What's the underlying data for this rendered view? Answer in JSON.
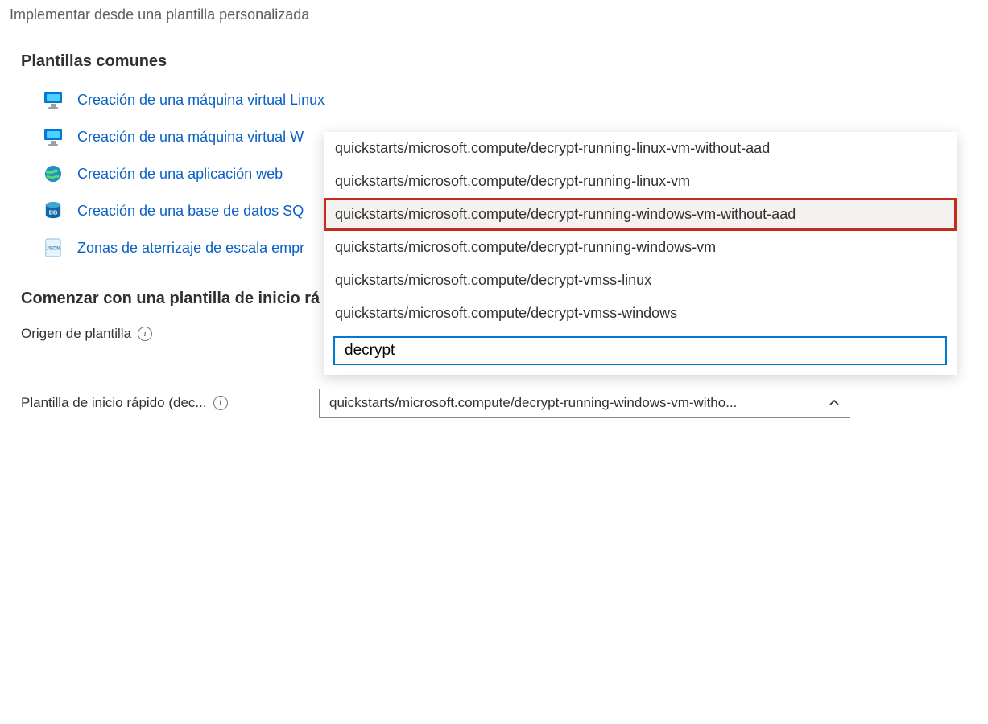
{
  "page": {
    "title": "Implementar desde una plantilla personalizada"
  },
  "common": {
    "heading": "Plantillas comunes",
    "items": [
      {
        "label": "Creación de una máquina virtual Linux",
        "icon": "monitor"
      },
      {
        "label": "Creación de una máquina virtual Windows",
        "label_truncated": "Creación de una máquina virtual W",
        "icon": "monitor"
      },
      {
        "label": "Creación de una aplicación web",
        "icon": "globe"
      },
      {
        "label": "Creación de una base de datos SQL",
        "label_truncated": "Creación de una base de datos SQ",
        "icon": "db"
      },
      {
        "label": "Zonas de aterrizaje de escala empresarial",
        "label_truncated": "Zonas de aterrizaje de escala empr",
        "icon": "json"
      }
    ]
  },
  "quickstart": {
    "heading": "Comenzar con una plantilla de inicio rápido o una especificación de plantilla",
    "heading_truncated": "Comenzar con una plantilla de inicio rá",
    "source_label": "Origen de plantilla",
    "template_label": "Plantilla de inicio rápido (dec...",
    "selected_display": "quickstarts/microsoft.compute/decrypt-running-windows-vm-witho..."
  },
  "dropdown": {
    "search_value": "decrypt",
    "options": [
      "quickstarts/microsoft.compute/decrypt-running-linux-vm-without-aad",
      "quickstarts/microsoft.compute/decrypt-running-linux-vm",
      "quickstarts/microsoft.compute/decrypt-running-windows-vm-without-aad",
      "quickstarts/microsoft.compute/decrypt-running-windows-vm",
      "quickstarts/microsoft.compute/decrypt-vmss-linux",
      "quickstarts/microsoft.compute/decrypt-vmss-windows"
    ],
    "highlighted_index": 2
  }
}
